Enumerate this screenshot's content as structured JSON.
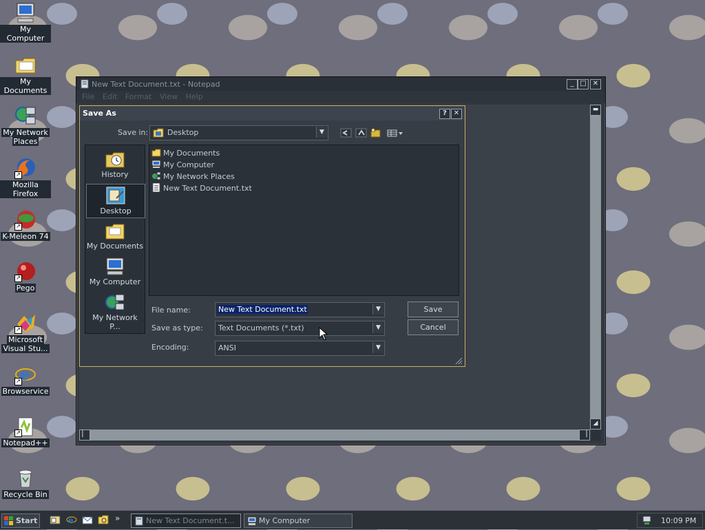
{
  "desktop_icons": [
    {
      "label1": "My Computer",
      "label2": ""
    },
    {
      "label1": "My Documents",
      "label2": ""
    },
    {
      "label1": "My Network",
      "label2": "Places"
    },
    {
      "label1": "Mozilla Firefox",
      "label2": ""
    },
    {
      "label1": "K-Meleon 74",
      "label2": ""
    },
    {
      "label1": "Pego",
      "label2": ""
    },
    {
      "label1": "Microsoft",
      "label2": "Visual Stu..."
    },
    {
      "label1": "Browservice",
      "label2": ""
    },
    {
      "label1": "Notepad++",
      "label2": ""
    },
    {
      "label1": "Recycle Bin",
      "label2": ""
    }
  ],
  "notepad": {
    "title": "New Text Document.txt - Notepad",
    "menu": [
      "File",
      "Edit",
      "Format",
      "View",
      "Help"
    ],
    "min_glyph": "_",
    "max_glyph": "□",
    "close_glyph": "✕"
  },
  "save_dialog": {
    "title": "Save As",
    "help_glyph": "?",
    "close_glyph": "✕",
    "save_in_label": "Save in:",
    "save_in_value": "Desktop",
    "places": [
      "History",
      "Desktop",
      "My Documents",
      "My Computer",
      "My Network P..."
    ],
    "selected_place": "Desktop",
    "files": [
      {
        "name": "My Documents",
        "icon": "folder-icon"
      },
      {
        "name": "My Computer",
        "icon": "computer-icon"
      },
      {
        "name": "My Network Places",
        "icon": "network-icon"
      },
      {
        "name": "New Text Document.txt",
        "icon": "text-file-icon"
      }
    ],
    "file_name_label": "File name:",
    "file_name_value": "New Text Document.txt",
    "save_as_type_label": "Save as type:",
    "save_as_type_value": "Text Documents (*.txt)",
    "encoding_label": "Encoding:",
    "encoding_value": "ANSI",
    "save_button": "Save",
    "cancel_button": "Cancel"
  },
  "taskbar": {
    "start": "Start",
    "chevron": "»",
    "tasks": [
      "New Text Document.t...",
      "My Computer"
    ],
    "clock": "10:09 PM"
  },
  "colors": {
    "dialog_border": "#c8b060",
    "selection": "#0a246a",
    "window_bg": "#313840"
  }
}
